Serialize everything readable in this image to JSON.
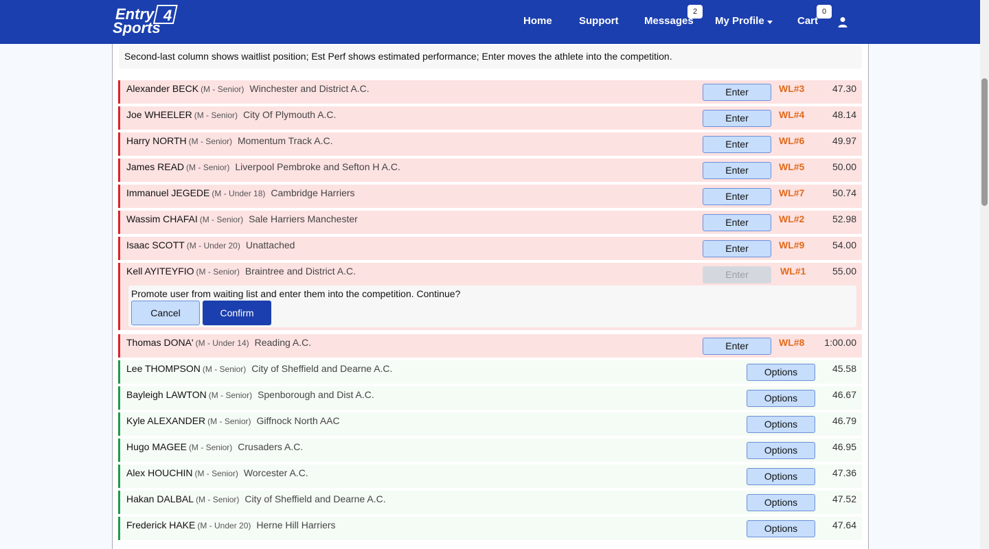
{
  "header": {
    "logo_text": "Entry 4 Sports",
    "nav": {
      "home": "Home",
      "support": "Support",
      "messages": "Messages",
      "messages_count": "2",
      "profile": "My Profile",
      "cart": "Cart",
      "cart_count": "0"
    }
  },
  "hint": "Second-last column shows waitlist position; Est Perf shows estimated performance; Enter moves the athlete into the competition.",
  "buttons": {
    "enter": "Enter",
    "options": "Options",
    "cancel": "Cancel",
    "confirm": "Confirm"
  },
  "confirm_message": "Promote user from waiting list and enter them into the competition. Continue?",
  "waitlist": [
    {
      "name": "Alexander BECK",
      "category": "(M - Senior)",
      "club": "Winchester and District A.C.",
      "position": "WL#3",
      "perf": "47.30"
    },
    {
      "name": "Joe WHEELER",
      "category": "(M - Senior)",
      "club": "City Of Plymouth A.C.",
      "position": "WL#4",
      "perf": "48.14"
    },
    {
      "name": "Harry NORTH",
      "category": "(M - Senior)",
      "club": "Momentum Track A.C.",
      "position": "WL#6",
      "perf": "49.97"
    },
    {
      "name": "James READ",
      "category": "(M - Senior)",
      "club": "Liverpool Pembroke and Sefton H A.C.",
      "position": "WL#5",
      "perf": "50.00"
    },
    {
      "name": "Immanuel JEGEDE",
      "category": "(M - Under 18)",
      "club": "Cambridge Harriers",
      "position": "WL#7",
      "perf": "50.74"
    },
    {
      "name": "Wassim CHAFAI",
      "category": "(M - Senior)",
      "club": "Sale Harriers Manchester",
      "position": "WL#2",
      "perf": "52.98"
    },
    {
      "name": "Isaac SCOTT",
      "category": "(M - Under 20)",
      "club": "Unattached",
      "position": "WL#9",
      "perf": "54.00"
    },
    {
      "name": "Kell AYITEYFIO",
      "category": "(M - Senior)",
      "club": "Braintree and District A.C.",
      "position": "WL#1",
      "perf": "55.00"
    },
    {
      "name": "Thomas DONA'",
      "category": "(M - Under 14)",
      "club": "Reading A.C.",
      "position": "WL#8",
      "perf": "1:00.00"
    }
  ],
  "entered": [
    {
      "name": "Lee THOMPSON",
      "category": "(M - Senior)",
      "club": "City of Sheffield and Dearne A.C.",
      "perf": "45.58"
    },
    {
      "name": "Bayleigh LAWTON",
      "category": "(M - Senior)",
      "club": "Spenborough and Dist A.C.",
      "perf": "46.67"
    },
    {
      "name": "Kyle ALEXANDER",
      "category": "(M - Senior)",
      "club": "Giffnock North AAC",
      "perf": "46.79"
    },
    {
      "name": "Hugo MAGEE",
      "category": "(M - Senior)",
      "club": "Crusaders A.C.",
      "perf": "46.95"
    },
    {
      "name": "Alex HOUCHIN",
      "category": "(M - Senior)",
      "club": "Worcester A.C.",
      "perf": "47.36"
    },
    {
      "name": "Hakan DALBAL",
      "category": "(M - Senior)",
      "club": "City of Sheffield and Dearne A.C.",
      "perf": "47.52"
    },
    {
      "name": "Frederick HAKE",
      "category": "(M - Under 20)",
      "club": "Herne Hill Harriers",
      "perf": "47.64"
    }
  ]
}
